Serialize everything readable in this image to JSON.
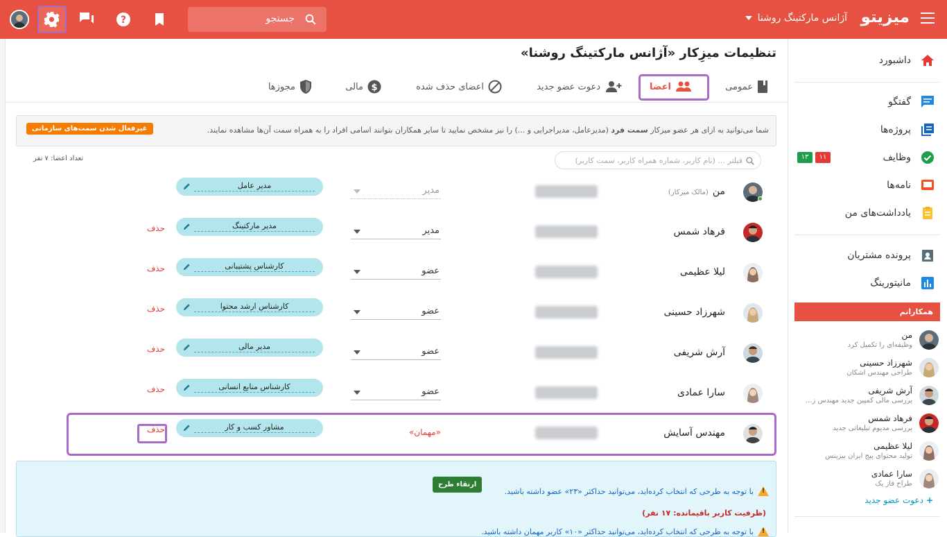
{
  "topbar": {
    "brand": "میزیتو",
    "workspace": "آژانس مارکتینگ روشنا",
    "search_placeholder": "جستجو"
  },
  "page": {
    "title": "تنظیمات میزِکار «آژانس مارکتینگ روشنا»"
  },
  "tabs": [
    {
      "label": "عمومی"
    },
    {
      "label": "اعضا"
    },
    {
      "label": "دعوت عضو جدید"
    },
    {
      "label": "اعضای حذف شده"
    },
    {
      "label": "مالی"
    },
    {
      "label": "مجوزها"
    }
  ],
  "notice": {
    "text_1": "شما می‌توانید به ازای هر عضو میزکار ",
    "text_bold": "سمت فرد",
    "text_2": " (مدیرعامل، مدیراجرایی و ...) را نیز مشخص نمایید تا سایر همکاران بتوانند اسامی افراد را به همراه سمت آن‌ها مشاهده نمایند.",
    "button": "غیرفعال شدن سمت‌های سازمانی"
  },
  "members": {
    "count": "تعداد اعضا: ۷ نفر",
    "filter_placeholder": "فیلتر ... (نام کاربر، شماره همراه کاربر، سمت کاربر)",
    "delete_label": "حذف",
    "rows": [
      {
        "name": "من",
        "note": "(مالک میزکار)",
        "role": "مدیر",
        "post": "مدیر عامل"
      },
      {
        "name": "فرهاد شمس",
        "role": "مدیر",
        "post": "مدیر مارکتینگ"
      },
      {
        "name": "لیلا عظیمی",
        "role": "عضو",
        "post": "کارشناس پشتیبانی"
      },
      {
        "name": "شهرزاد حسینی",
        "role": "عضو",
        "post": "کارشناس ارشد محتوا"
      },
      {
        "name": "آرش شریفی",
        "role": "عضو",
        "post": "مدیر مالی"
      },
      {
        "name": "سارا عمادی",
        "role": "عضو",
        "post": "کارشناس منابع انسانی"
      },
      {
        "name": "مهندس آسایش",
        "role": "«مهمان»",
        "post": "مشاور کسب و کار"
      }
    ]
  },
  "plan": {
    "line1": "با توجه به طرحی که انتخاب کرده‌اید، می‌توانید حداکثر «۲۳» عضو داشته باشید.",
    "line2": "(ظرفیت کاربر باقیمانده: ۱۷ نفر)",
    "line3": "با توجه به طرحی که انتخاب کرده‌اید، می‌توانید حداکثر «۱۰» کاربر مهمان داشته باشید.",
    "upgrade": "ارتقاء طرح"
  },
  "sidebar": {
    "items": [
      {
        "label": "داشبورد"
      },
      {
        "label": "گفتگو"
      },
      {
        "label": "پروژه‌ها"
      },
      {
        "label": "وظایف",
        "badge_green": "۱۳",
        "badge_red": "۱۱"
      },
      {
        "label": "نامه‌ها"
      },
      {
        "label": "یادداشت‌های من"
      },
      {
        "label": "پرونده مشتریان"
      },
      {
        "label": "مانیتورینگ"
      }
    ],
    "coworkers_title": "همکارانم",
    "coworkers": [
      {
        "name": "من",
        "sub": "وظیفه‌ای را تکمیل کرد"
      },
      {
        "name": "شهرزاد حسینی",
        "sub": "طراحی مهندس اشکان"
      },
      {
        "name": "آرش شریفی",
        "sub": "بررسی مالی کمپین جدید مهندس ز..."
      },
      {
        "name": "فرهاد شمس",
        "sub": "بررسی مدیوم تبلیغاتی جدید"
      },
      {
        "name": "لیلا عظیمی",
        "sub": "تولید محتوای پیج ایران بیزینس"
      },
      {
        "name": "سارا عمادی",
        "sub": "طراح فاز یک"
      }
    ],
    "invite": "دعوت عضو جدید"
  },
  "colors": {
    "brand": "#e65142",
    "highlight": "#a66bc6",
    "post_bg": "#b3e5ec"
  }
}
